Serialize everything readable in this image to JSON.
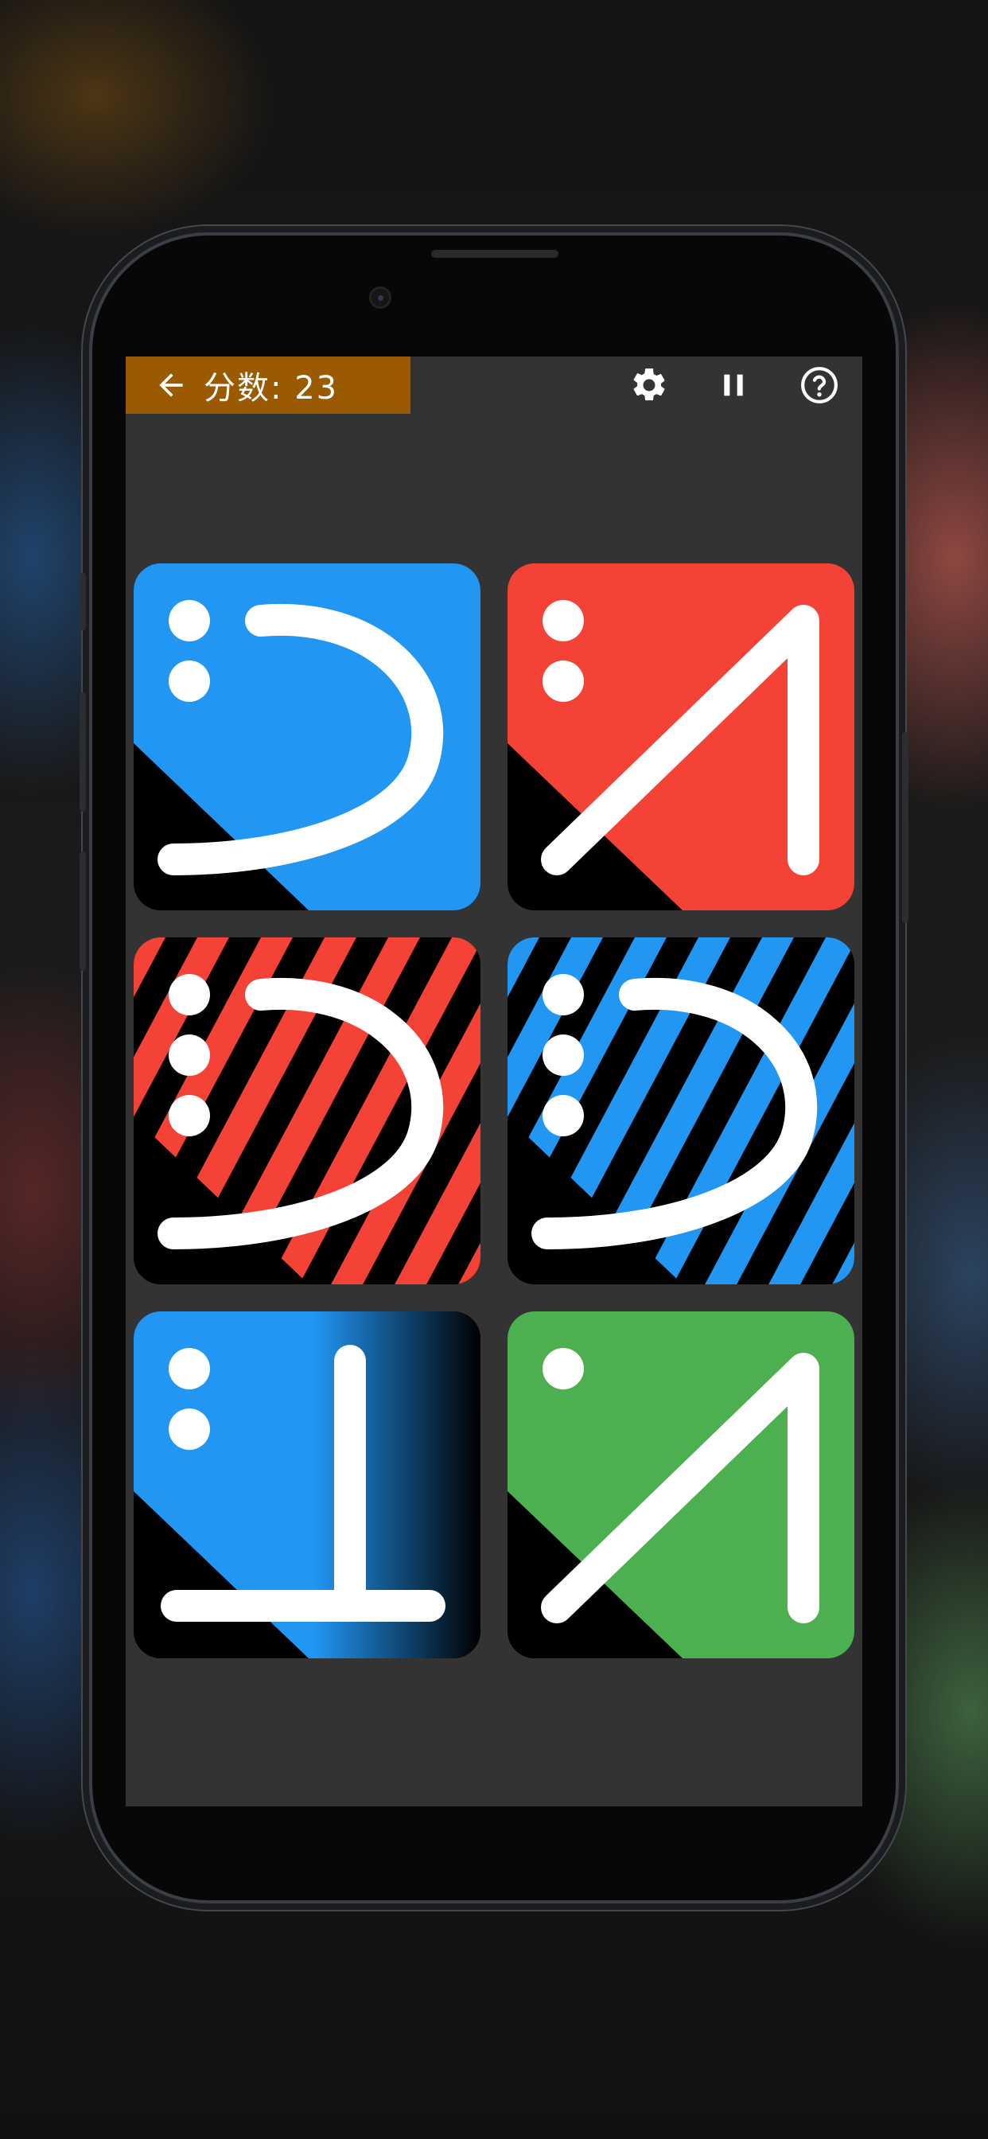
{
  "header": {
    "score_label": "分数: 23",
    "back_icon": "arrow-left-icon",
    "settings_icon": "gear-icon",
    "pause_icon": "pause-icon",
    "help_icon": "help-circle-icon"
  },
  "colors": {
    "score_bg": "#9b5a00",
    "screen_bg": "#333333",
    "blue": "#2196f3",
    "red": "#f44336",
    "green": "#4caf50",
    "symbol": "#ffffff"
  },
  "tiles": [
    {
      "id": "tile-1",
      "color": "blue",
      "pattern": "solid",
      "symbol": "arc",
      "dots": 2
    },
    {
      "id": "tile-2",
      "color": "red",
      "pattern": "solid",
      "symbol": "angle",
      "dots": 2
    },
    {
      "id": "tile-3",
      "color": "red",
      "pattern": "striped",
      "symbol": "arc",
      "dots": 3
    },
    {
      "id": "tile-4",
      "color": "blue",
      "pattern": "striped",
      "symbol": "arc",
      "dots": 3
    },
    {
      "id": "tile-5",
      "color": "blue",
      "pattern": "gradient",
      "symbol": "t-shape",
      "dots": 2
    },
    {
      "id": "tile-6",
      "color": "green",
      "pattern": "solid",
      "symbol": "angle",
      "dots": 1
    }
  ]
}
